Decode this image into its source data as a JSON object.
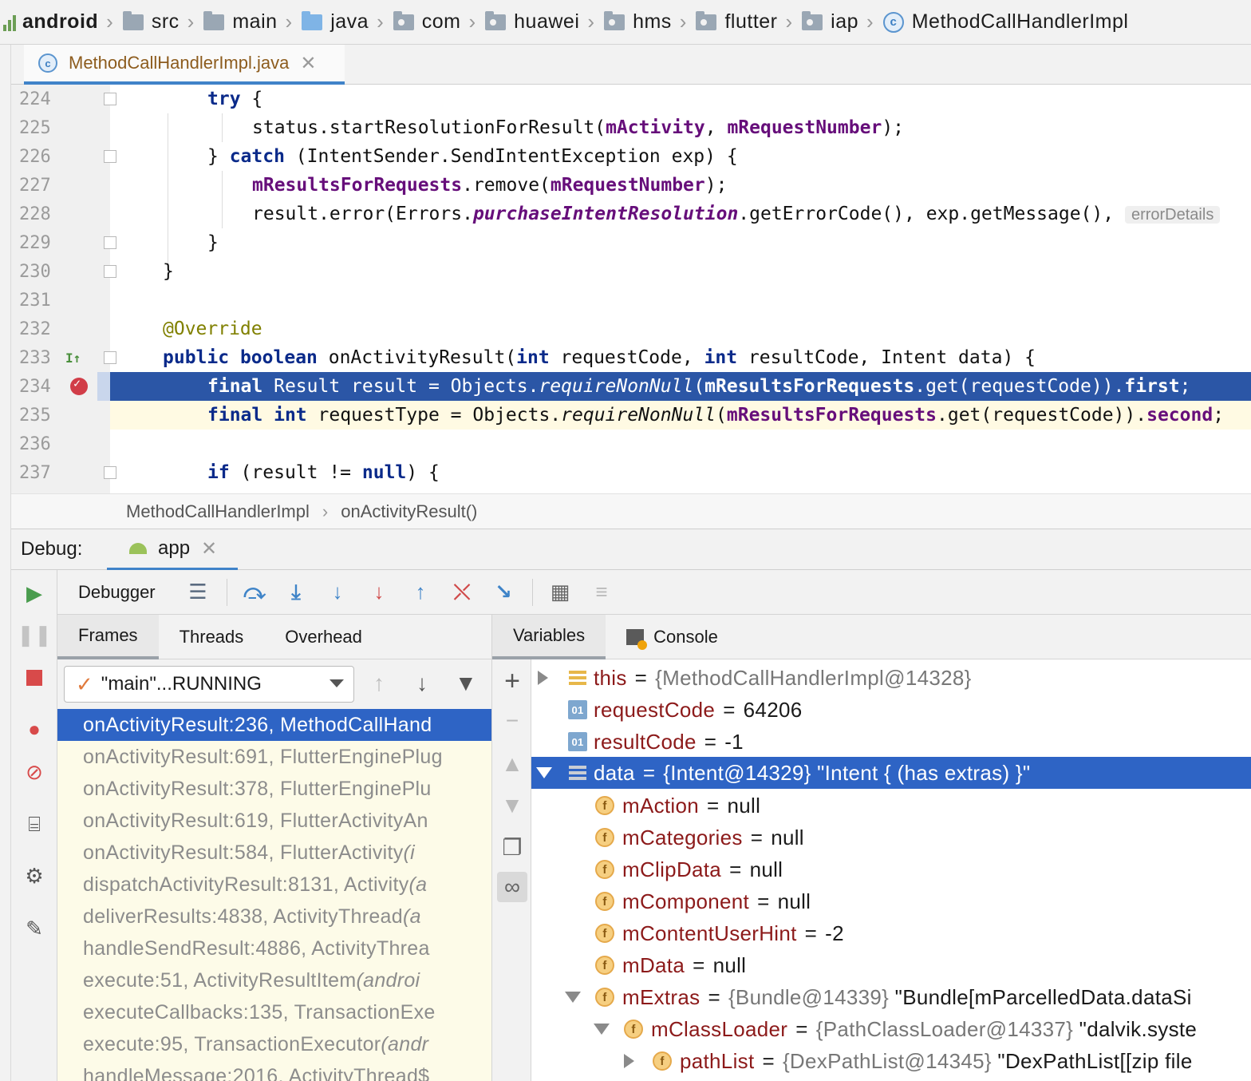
{
  "breadcrumbs": [
    {
      "label": "android",
      "icon": "module-icon"
    },
    {
      "label": "src",
      "icon": "folder-icon"
    },
    {
      "label": "main",
      "icon": "folder-icon"
    },
    {
      "label": "java",
      "icon": "source-folder-icon"
    },
    {
      "label": "com",
      "icon": "package-icon"
    },
    {
      "label": "huawei",
      "icon": "package-icon"
    },
    {
      "label": "hms",
      "icon": "package-icon"
    },
    {
      "label": "flutter",
      "icon": "package-icon"
    },
    {
      "label": "iap",
      "icon": "package-icon"
    },
    {
      "label": "MethodCallHandlerImpl",
      "icon": "class-icon"
    }
  ],
  "editor_tab": {
    "label": "MethodCallHandlerImpl.java",
    "icon_letter": "c",
    "close": "✕"
  },
  "code": {
    "lines": [
      "224",
      "225",
      "226",
      "227",
      "228",
      "229",
      "230",
      "231",
      "232",
      "233",
      "234",
      "235",
      "236",
      "237"
    ],
    "t224": {
      "kw": "try",
      "rest": " {"
    },
    "t225": {
      "a": "status.startResolutionForResult(",
      "f1": "mActivity",
      "b": ", ",
      "f2": "mRequestNumber",
      "c": ");"
    },
    "t226": {
      "a": "} ",
      "kw": "catch",
      "b": " (IntentSender.SendIntentException exp) {"
    },
    "t227": {
      "f1": "mResultsForRequests",
      "a": ".remove(",
      "f2": "mRequestNumber",
      "b": ");"
    },
    "t228": {
      "a": "result.error(Errors.",
      "s": "purchaseIntentResolution",
      "b": ".getErrorCode(), exp.getMessage(), ",
      "hint": "errorDetails"
    },
    "t229": "}",
    "t230": "}",
    "t232": "@Override",
    "t233": {
      "k1": "public",
      "k2": "boolean",
      "a": " onActivityResult(",
      "k3": "int",
      "b": " requestCode, ",
      "k4": "int",
      "c": " resultCode, Intent data) {"
    },
    "t234": {
      "k1": "final",
      "a": " Result result = Objects.",
      "m": "requireNonNull",
      "b": "(",
      "f": "mResultsForRequests",
      "c": ".get(requestCode)).",
      "f2": "first",
      "d": ";"
    },
    "t235": {
      "k1": "final",
      "k2": "int",
      "a": " requestType = Objects.",
      "m": "requireNonNull",
      "b": "(",
      "f": "mResultsForRequests",
      "c": ".get(requestCode)).",
      "f2": "second",
      "d": ";"
    },
    "t237": {
      "kw": "if",
      "a": " (result != ",
      "k2": "null",
      "b": ") {"
    }
  },
  "code_breadcrumb": {
    "cls": "MethodCallHandlerImpl",
    "method": "onActivityResult()"
  },
  "debug": {
    "title": "Debug:",
    "app_tab": "app",
    "toolbar_label": "Debugger",
    "frames_tabs": [
      "Frames",
      "Threads",
      "Overhead"
    ],
    "vars_tabs": [
      "Variables",
      "Console"
    ],
    "thread": "\"main\"...RUNNING",
    "frames": [
      {
        "text": "onActivityResult:236, MethodCallHand",
        "italic": ""
      },
      {
        "text": "onActivityResult:691, FlutterEnginePlug",
        "italic": ""
      },
      {
        "text": "onActivityResult:378, FlutterEnginePlu",
        "italic": ""
      },
      {
        "text": "onActivityResult:619, FlutterActivityAn",
        "italic": ""
      },
      {
        "text": "onActivityResult:584, FlutterActivity ",
        "italic": "(i"
      },
      {
        "text": "dispatchActivityResult:8131, Activity ",
        "italic": "(a"
      },
      {
        "text": "deliverResults:4838, ActivityThread ",
        "italic": "(a"
      },
      {
        "text": "handleSendResult:4886, ActivityThrea",
        "italic": ""
      },
      {
        "text": "execute:51, ActivityResultItem ",
        "italic": "(androi"
      },
      {
        "text": "executeCallbacks:135, TransactionExe",
        "italic": ""
      },
      {
        "text": "execute:95, TransactionExecutor ",
        "italic": "(andr"
      },
      {
        "text": "handleMessage:2016, ActivityThread$",
        "italic": ""
      }
    ],
    "variables": [
      {
        "name": "this",
        "value": "{MethodCallHandlerImpl@14328}",
        "icon": "object-icon"
      },
      {
        "name": "requestCode",
        "value": "64206",
        "icon": "primitive-icon"
      },
      {
        "name": "resultCode",
        "value": "-1",
        "icon": "primitive-icon"
      },
      {
        "name": "data",
        "value": "{Intent@14329} \"Intent { (has extras) }\"",
        "icon": "object-icon"
      },
      {
        "name": "mAction",
        "value": "null",
        "icon": "field-icon"
      },
      {
        "name": "mCategories",
        "value": "null",
        "icon": "field-icon"
      },
      {
        "name": "mClipData",
        "value": "null",
        "icon": "field-icon"
      },
      {
        "name": "mComponent",
        "value": "null",
        "icon": "field-icon"
      },
      {
        "name": "mContentUserHint",
        "value": "-2",
        "icon": "field-icon"
      },
      {
        "name": "mData",
        "value": "null",
        "icon": "field-icon"
      },
      {
        "name": "mExtras",
        "value_gray": "{Bundle@14339}",
        "value": " \"Bundle[mParcelledData.dataSi",
        "icon": "field-icon"
      },
      {
        "name": "mClassLoader",
        "value_gray": "{PathClassLoader@14337}",
        "value": " \"dalvik.syste",
        "icon": "field-icon"
      },
      {
        "name": "pathList",
        "value_gray": "{DexPathList@14345}",
        "value": " \"DexPathList[[zip file",
        "icon": "field-icon"
      }
    ],
    "prim_icon_text": "01",
    "field_icon_text": "f"
  }
}
